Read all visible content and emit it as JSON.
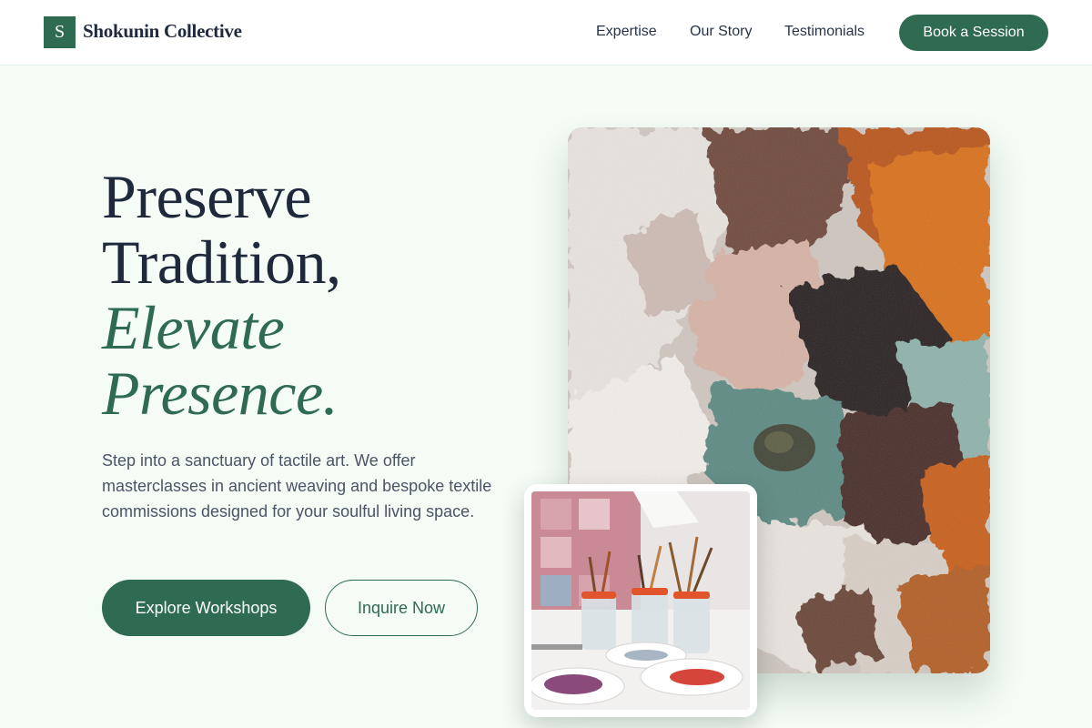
{
  "header": {
    "logo_letter": "S",
    "brand_name": "Shokunin Collective",
    "nav": [
      "Expertise",
      "Our Story",
      "Testimonials"
    ],
    "cta": "Book a Session"
  },
  "hero": {
    "headline_lines": [
      "Preserve",
      "Tradition,"
    ],
    "headline_accent_lines": [
      "Elevate",
      "Presence."
    ],
    "description": "Step into a sanctuary of tactile art. We offer masterclasses in ancient weaving and bespoke textile commissions designed for your soulful living space.",
    "primary_button": "Explore Workshops",
    "secondary_button": "Inquire Now"
  },
  "images": {
    "main": "textured-impasto-painting",
    "inset": "paint-brushes-in-jars-studio"
  },
  "colors": {
    "accent": "#2f6b50",
    "page_background": "#f4fcf5",
    "heading": "#1e293b",
    "body_text": "#4b5565"
  }
}
